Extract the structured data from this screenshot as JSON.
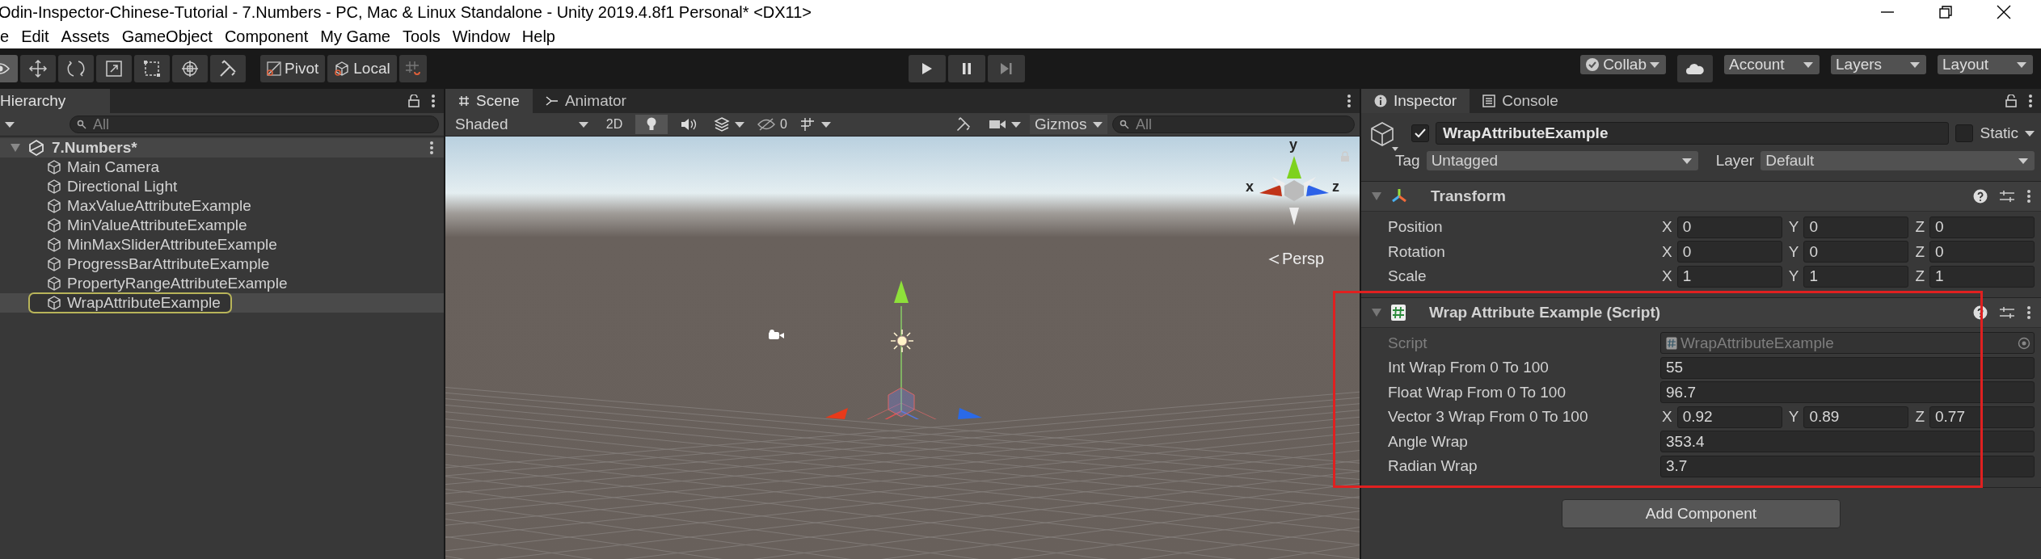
{
  "window": {
    "title": "Odin-Inspector-Chinese-Tutorial - 7.Numbers - PC, Mac & Linux Standalone - Unity 2019.4.8f1 Personal* <DX11>"
  },
  "menu_bar": [
    "e",
    "Edit",
    "Assets",
    "GameObject",
    "Component",
    "My Game",
    "Tools",
    "Window",
    "Help"
  ],
  "toolbar": {
    "tools": [
      {
        "kind": "view",
        "selected": true
      },
      {
        "kind": "move",
        "selected": false
      },
      {
        "kind": "rotate",
        "selected": false
      },
      {
        "kind": "scale",
        "selected": false
      },
      {
        "kind": "rect",
        "selected": false
      },
      {
        "kind": "transform",
        "selected": false
      },
      {
        "kind": "custom",
        "selected": false
      }
    ],
    "pivot": "Pivot",
    "local": "Local",
    "collab": "Collab",
    "account": "Account",
    "layers": "Layers",
    "layout": "Layout"
  },
  "hierarchy": {
    "tab": "Hierarchy",
    "search_placeholder": "All",
    "scene": {
      "name": "7.Numbers*",
      "expanded": true,
      "children": [
        {
          "name": "Main Camera",
          "selected": false
        },
        {
          "name": "Directional Light",
          "selected": false
        },
        {
          "name": "MaxValueAttributeExample",
          "selected": false
        },
        {
          "name": "MinValueAttributeExample",
          "selected": false
        },
        {
          "name": "MinMaxSliderAttributeExample",
          "selected": false
        },
        {
          "name": "ProgressBarAttributeExample",
          "selected": false
        },
        {
          "name": "PropertyRangeAttributeExample",
          "selected": false
        },
        {
          "name": "WrapAttributeExample",
          "selected": true
        }
      ]
    }
  },
  "scene_view": {
    "tabs": [
      {
        "label": "Scene",
        "kind": "scene",
        "selected": true
      },
      {
        "label": "Animator",
        "kind": "animator",
        "selected": false
      }
    ],
    "shading": "Shaded",
    "mode_2d": "2D",
    "lighting": true,
    "hidden_count": "0",
    "gizmos": "Gizmos",
    "search_placeholder": "All",
    "axis_labels": [
      "x",
      "y",
      "z"
    ],
    "projection": "Persp"
  },
  "inspector": {
    "tabs": [
      {
        "label": "Inspector",
        "kind": "inspector",
        "selected": true
      },
      {
        "label": "Console",
        "kind": "console",
        "selected": false
      }
    ],
    "object": {
      "active": true,
      "name": "WrapAttributeExample",
      "static_label": "Static",
      "static": false,
      "tag_label": "Tag",
      "tag": "Untagged",
      "layer_label": "Layer",
      "layer": "Default"
    },
    "components": [
      {
        "title": "Transform",
        "kind": "transform",
        "expanded": true,
        "rows": [
          {
            "label": "Position",
            "kind": "vector",
            "disabled": false,
            "values": [
              {
                "axis": "X",
                "value": "0"
              },
              {
                "axis": "Y",
                "value": "0"
              },
              {
                "axis": "Z",
                "value": "0"
              }
            ]
          },
          {
            "label": "Rotation",
            "kind": "vector",
            "disabled": false,
            "values": [
              {
                "axis": "X",
                "value": "0"
              },
              {
                "axis": "Y",
                "value": "0"
              },
              {
                "axis": "Z",
                "value": "0"
              }
            ]
          },
          {
            "label": "Scale",
            "kind": "vector",
            "disabled": false,
            "values": [
              {
                "axis": "X",
                "value": "1"
              },
              {
                "axis": "Y",
                "value": "1"
              },
              {
                "axis": "Z",
                "value": "1"
              }
            ]
          }
        ]
      },
      {
        "title": "Wrap Attribute Example (Script)",
        "kind": "script",
        "expanded": true,
        "rows": [
          {
            "label": "Script",
            "kind": "object",
            "disabled": true,
            "value": "WrapAttributeExample"
          },
          {
            "label": "Int Wrap From 0 To 100",
            "kind": "field",
            "disabled": false,
            "value": "55"
          },
          {
            "label": "Float Wrap From 0 To 100",
            "kind": "field",
            "disabled": false,
            "value": "96.7"
          },
          {
            "label": "Vector 3 Wrap From 0 To 100",
            "kind": "vector",
            "disabled": false,
            "values": [
              {
                "axis": "X",
                "value": "0.92"
              },
              {
                "axis": "Y",
                "value": "0.89"
              },
              {
                "axis": "Z",
                "value": "0.77"
              }
            ]
          },
          {
            "label": "Angle Wrap",
            "kind": "field",
            "disabled": false,
            "value": "353.4"
          },
          {
            "label": "Radian Wrap",
            "kind": "field",
            "disabled": false,
            "value": "3.7"
          }
        ]
      }
    ],
    "add_component": "Add Component"
  }
}
